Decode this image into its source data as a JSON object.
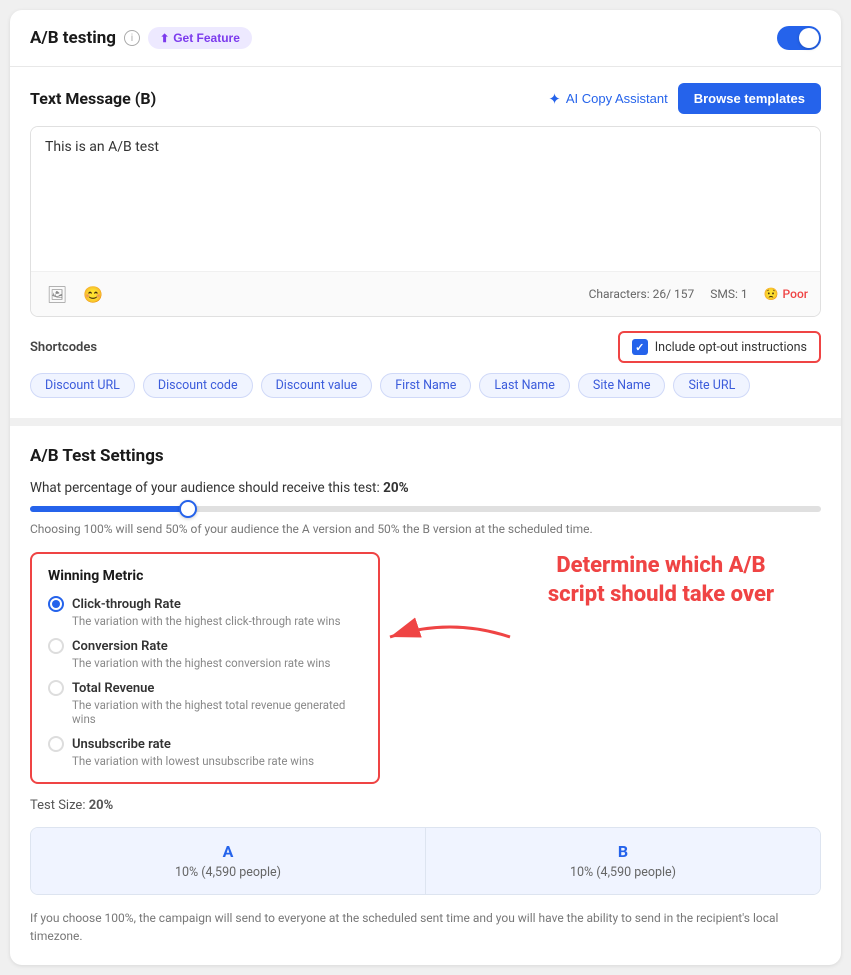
{
  "header": {
    "title": "A/B testing",
    "get_feature_label": "Get Feature",
    "toggle_on": true
  },
  "text_message": {
    "title": "Text Message (B)",
    "ai_copy_label": "AI Copy Assistant",
    "browse_templates_label": "Browse templates",
    "content": "This is an A/B test",
    "characters": "Characters: 26/ 157",
    "sms": "SMS: 1",
    "quality": "Poor",
    "opt_out_label": "Include opt-out instructions"
  },
  "shortcodes": {
    "title": "Shortcodes",
    "tags": [
      "Discount URL",
      "Discount code",
      "Discount value",
      "First Name",
      "Last Name",
      "Site Name",
      "Site URL"
    ]
  },
  "ab_settings": {
    "title": "A/B Test Settings",
    "percentage_question": "What percentage of your audience should receive this test:",
    "percentage_value": "20%",
    "slider_note": "Choosing 100% will send 50% of your audience the A version and 50% the B version at the scheduled time.",
    "winning_metric": {
      "title": "Winning Metric",
      "options": [
        {
          "label": "Click-through Rate",
          "desc": "The variation with the highest click-through rate wins",
          "selected": true
        },
        {
          "label": "Conversion Rate",
          "desc": "The variation with the highest conversion rate wins",
          "selected": false
        },
        {
          "label": "Total Revenue",
          "desc": "The variation with the highest total revenue generated wins",
          "selected": false
        },
        {
          "label": "Unsubscribe rate",
          "desc": "The variation with lowest unsubscribe rate wins",
          "selected": false
        }
      ]
    },
    "annotation": "Determine which A/B script should take over",
    "test_size_label": "Test Size:",
    "test_size_value": "20%",
    "split_a": {
      "letter": "A",
      "detail": "10% (4,590 people)"
    },
    "split_b": {
      "letter": "B",
      "detail": "10% (4,590 people)"
    },
    "footer_note": "If you choose 100%, the campaign will send to everyone at the scheduled sent time and you will have the ability to send in the recipient's local timezone."
  }
}
